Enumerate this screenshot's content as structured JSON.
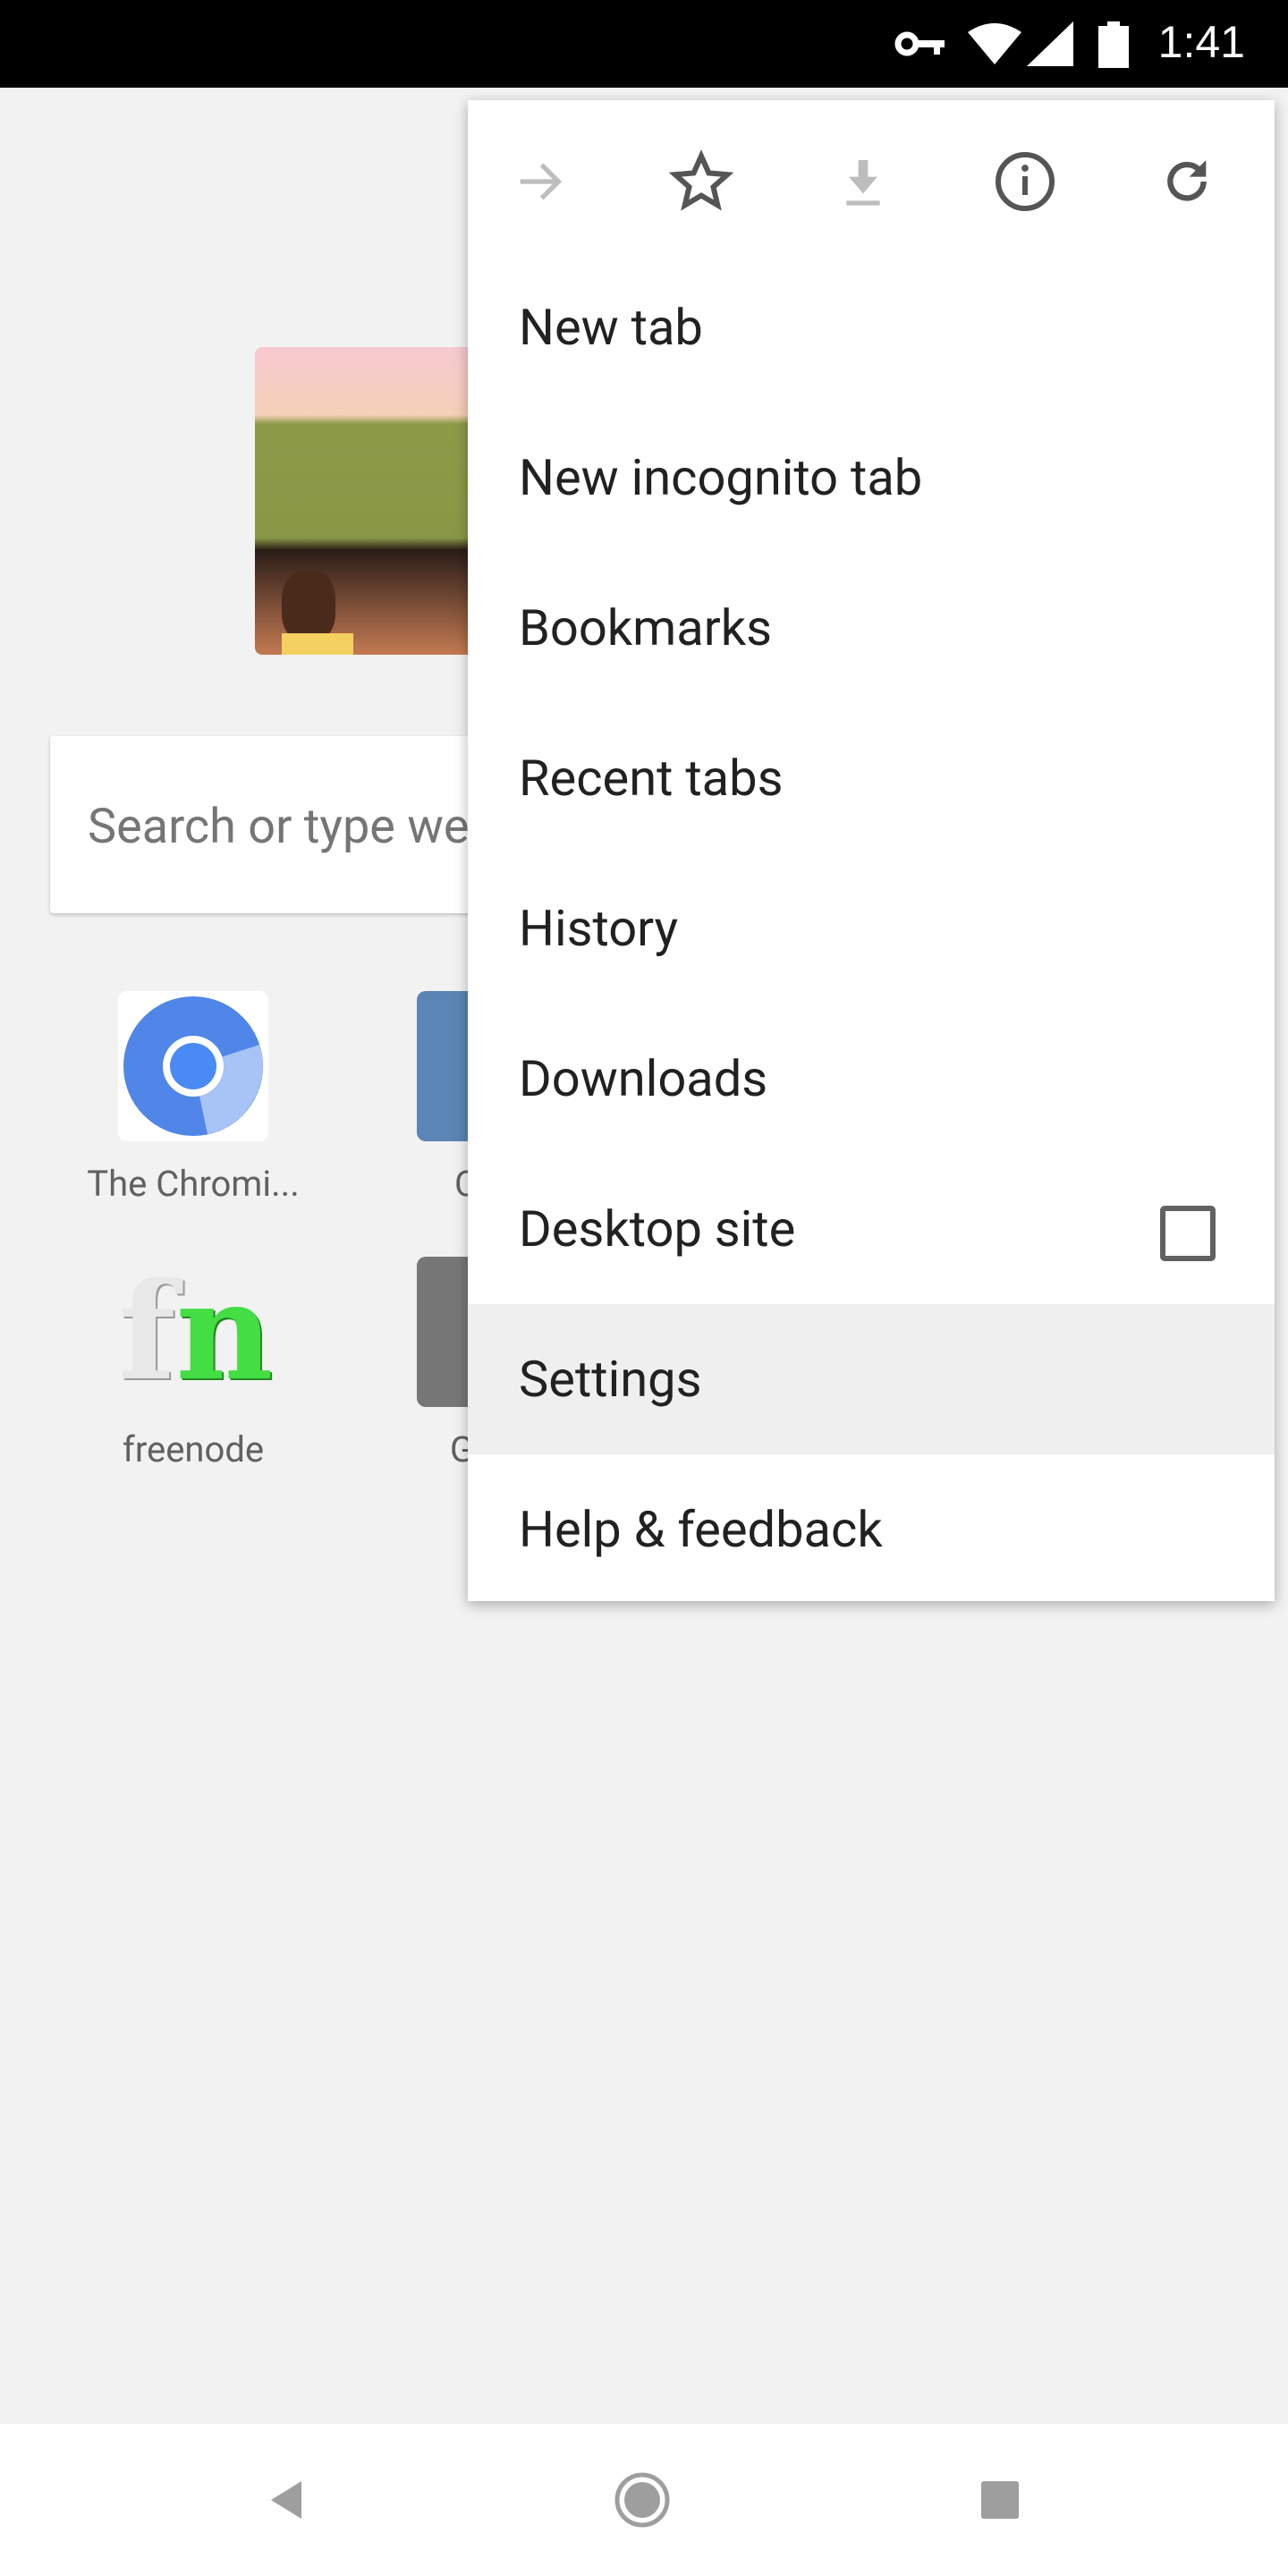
{
  "status_bar": {
    "time": "1:41",
    "icons": [
      "vpn-key-icon",
      "wifi-icon",
      "cell-signal-icon",
      "battery-icon"
    ]
  },
  "ntp": {
    "search_placeholder": "Search or type web address",
    "tiles": [
      {
        "label": "The Chromi...",
        "icon": "chromium-icon"
      },
      {
        "label": "Chro",
        "icon": "chrome-tile-icon"
      },
      {
        "label": "freenode",
        "icon": "freenode-icon"
      },
      {
        "label": "Githu",
        "icon": "github-tile-icon"
      }
    ]
  },
  "menu": {
    "icon_row": [
      "forward-icon",
      "bookmark-star-icon",
      "download-icon",
      "info-icon",
      "reload-icon"
    ],
    "items": [
      {
        "label": "New tab"
      },
      {
        "label": "New incognito tab"
      },
      {
        "label": "Bookmarks"
      },
      {
        "label": "Recent tabs"
      },
      {
        "label": "History"
      },
      {
        "label": "Downloads"
      },
      {
        "label": "Desktop site",
        "checkbox": false
      },
      {
        "label": "Settings",
        "highlighted": true
      },
      {
        "label": "Help & feedback"
      }
    ]
  },
  "colors": {
    "status_bar": "#000000",
    "background": "#f2f2f2",
    "menu_highlight": "#efefef",
    "freenode_green": "#44dd44"
  }
}
